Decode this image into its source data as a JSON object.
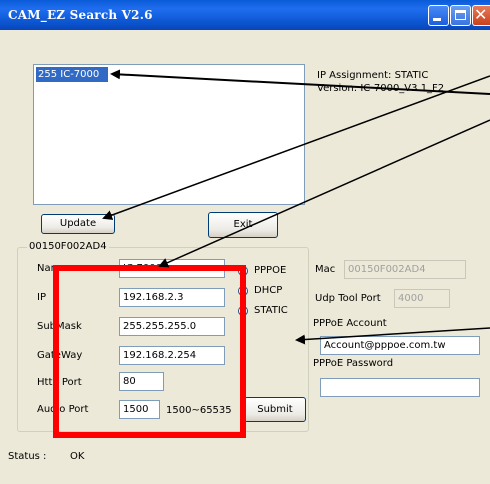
{
  "window": {
    "title": "CAM_EZ Search V2.6"
  },
  "device_list": {
    "items": [
      "255 IC-7000"
    ]
  },
  "device_info": {
    "ip_assignment": "IP Assignment:  STATIC",
    "version": "Version: IC-7000_V3.1_F2"
  },
  "buttons": {
    "update": "Update",
    "exit": "Exit",
    "submit": "Submit"
  },
  "group": {
    "title": "00150F002AD4"
  },
  "form": {
    "name_label": "Name",
    "name_value": "IC-7000",
    "ip_label": "IP",
    "ip_value": "192.168.2.3",
    "subnet_label": "SubMask",
    "subnet_value": "255.255.255.0",
    "gateway_label": "GateWay",
    "gateway_value": "192.168.2.254",
    "http_label": "Http Port",
    "http_value": "80",
    "audio_label": "Audio Port",
    "audio_value": "1500",
    "audio_range": "1500~65535"
  },
  "mode": {
    "options": [
      "PPPOE",
      "DHCP",
      "STATIC"
    ],
    "selected": "STATIC"
  },
  "right": {
    "mac_label": "Mac",
    "mac_value": "00150F002AD4",
    "udp_label": "Udp Tool Port",
    "udp_value": "4000",
    "pppoe_account_label": "PPPoE Account",
    "pppoe_account_value": "Account@pppoe.com.tw",
    "pppoe_password_label": "PPPoE Password",
    "pppoe_password_value": ""
  },
  "status": {
    "label": "Status :",
    "value": "OK"
  }
}
